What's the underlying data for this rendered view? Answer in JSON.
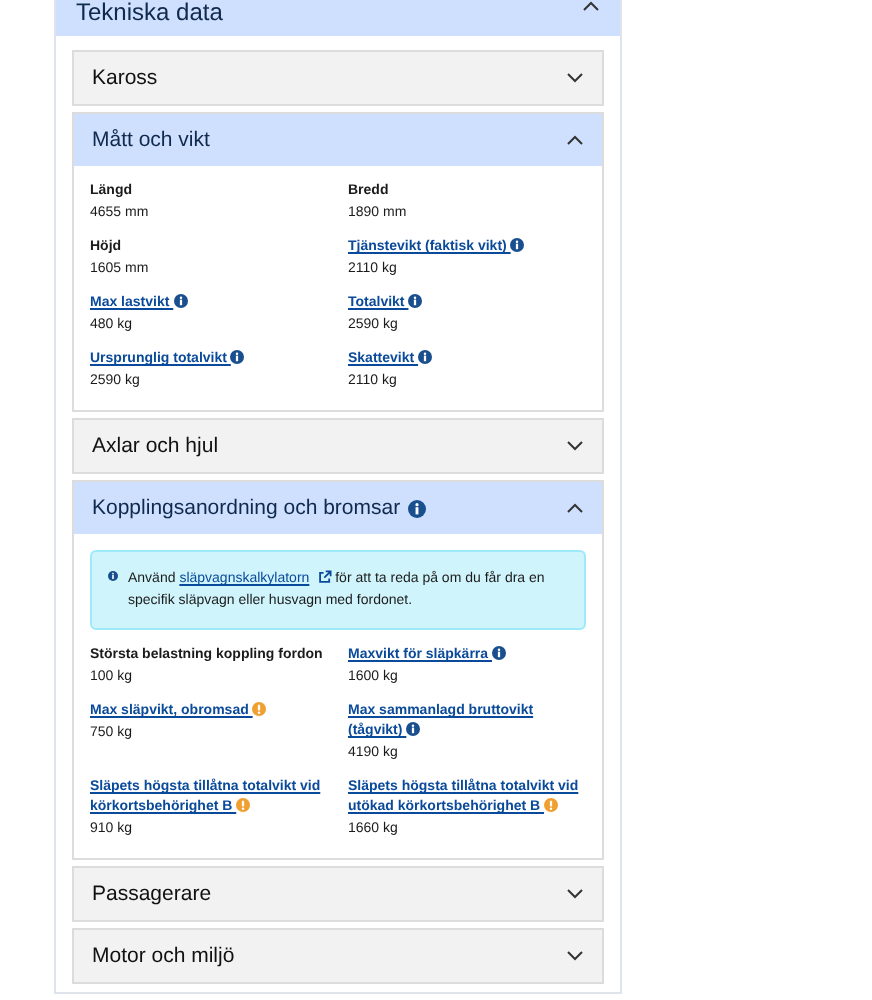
{
  "panel": {
    "title": "Tekniska data",
    "expanded": true
  },
  "sections": [
    {
      "title": "Kaross",
      "expanded": false
    },
    {
      "title": "Mått och vikt",
      "expanded": true,
      "fields": [
        {
          "label": "Längd",
          "value": "4655 mm",
          "link": false
        },
        {
          "label": "Bredd",
          "value": "1890 mm",
          "link": false
        },
        {
          "label": "Höjd",
          "value": "1605 mm",
          "link": false
        },
        {
          "label": "Tjänstevikt (faktisk vikt)",
          "value": "2110 kg",
          "link": true,
          "info": true
        },
        {
          "label": "Max lastvikt",
          "value": "480 kg",
          "link": true,
          "info": true
        },
        {
          "label": "Totalvikt",
          "value": "2590 kg",
          "link": true,
          "info": true
        },
        {
          "label": "Ursprunglig totalvikt",
          "value": "2590 kg",
          "link": true,
          "info": true
        },
        {
          "label": "Skattevikt",
          "value": "2110 kg",
          "link": true,
          "info": true
        }
      ]
    },
    {
      "title": "Axlar och hjul",
      "expanded": false
    },
    {
      "title": "Kopplingsanordning och bromsar",
      "expanded": true,
      "info": true,
      "alert": {
        "before": "Använd",
        "link": "släpvagnskalkylatorn",
        "after": "för att ta reda på om du får dra en specifik släpvagn eller husvagn med fordonet."
      },
      "fields": [
        {
          "label": "Största belastning koppling fordon",
          "value": "100 kg",
          "link": false
        },
        {
          "label": "Maxvikt för släpkärra",
          "value": "1600 kg",
          "link": true,
          "info": true
        },
        {
          "label": "Max släpvikt, obromsad",
          "value": "750 kg",
          "link": true,
          "warning": true
        },
        {
          "label": "Max sammanlagd bruttovikt (tågvikt)",
          "value": "4190 kg",
          "link": true,
          "info": true
        },
        {
          "label": "Släpets högsta tillåtna totalvikt vid körkortsbehörighet B",
          "value": "910 kg",
          "link": true,
          "warning": true
        },
        {
          "label": "Släpets högsta tillåtna totalvikt vid utökad körkortsbehörighet B",
          "value": "1660 kg",
          "link": true,
          "warning": true
        }
      ]
    },
    {
      "title": "Passagerare",
      "expanded": false
    },
    {
      "title": "Motor och miljö",
      "expanded": false
    }
  ]
}
